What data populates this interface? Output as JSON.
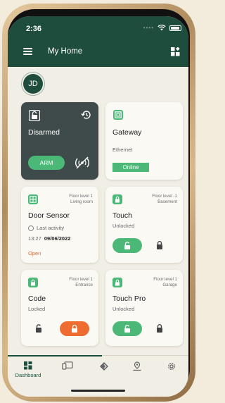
{
  "status_bar": {
    "time": "2:36"
  },
  "app_bar": {
    "title": "My Home"
  },
  "user": {
    "initials": "JD"
  },
  "cards": {
    "alarm": {
      "status": "Disarmed",
      "arm_label": "ARM"
    },
    "gateway": {
      "title": "Gateway",
      "connection": "Ethernet",
      "status": "Online"
    },
    "door_sensor": {
      "title": "Door Sensor",
      "floor": "Floor level 1",
      "room": "Living room",
      "last_activity_label": "Last activity",
      "time": "13:27",
      "date": "09/06/2022",
      "state": "Open"
    },
    "touch": {
      "title": "Touch",
      "floor": "Floor level -1",
      "room": "Basement",
      "state": "Unlocked"
    },
    "code": {
      "title": "Code",
      "floor": "Floor level 1",
      "room": "Entrance",
      "state": "Locked"
    },
    "touch_pro": {
      "title": "Touch Pro",
      "floor": "Floor level 1",
      "room": "Garage",
      "state": "Unlocked"
    }
  },
  "bottom_nav": {
    "dashboard_label": "Dashboard"
  },
  "colors": {
    "brand_green": "#1e4d3e",
    "accent_green": "#4cb877",
    "accent_orange": "#ef6c31",
    "alarm_card": "#3f4a4a"
  }
}
